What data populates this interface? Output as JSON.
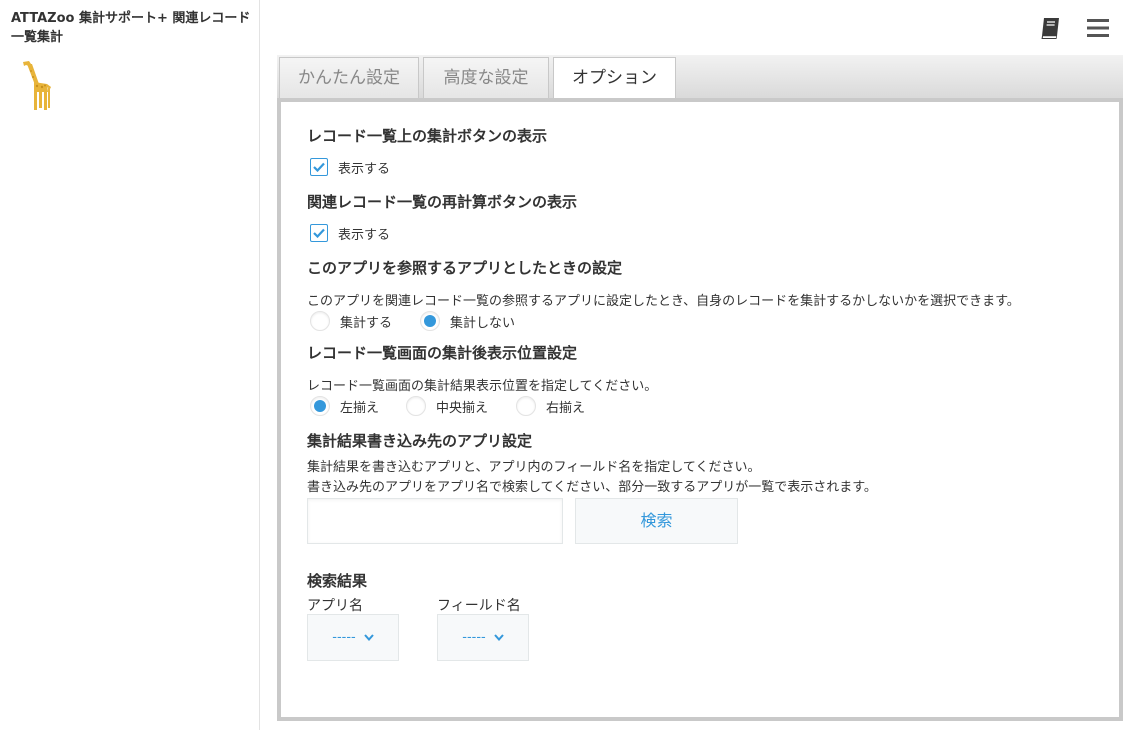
{
  "sidebar": {
    "app_title": "ATTAZoo 集計サポート+ 関連レコード一覧集計",
    "logo_icon": "giraffe-icon"
  },
  "header": {
    "icons": [
      "book-icon",
      "menu-icon"
    ]
  },
  "tabs": [
    {
      "label": "かんたん設定",
      "active": false
    },
    {
      "label": "高度な設定",
      "active": false
    },
    {
      "label": "オプション",
      "active": true
    }
  ],
  "sections": {
    "list_button": {
      "title": "レコード一覧上の集計ボタンの表示",
      "checkbox_label": "表示する",
      "checked": true
    },
    "recalc_button": {
      "title": "関連レコード一覧の再計算ボタンの表示",
      "checkbox_label": "表示する",
      "checked": true
    },
    "reference_app": {
      "title": "このアプリを参照するアプリとしたときの設定",
      "description": "このアプリを関連レコード一覧の参照するアプリに設定したとき、自身のレコードを集計するかしないかを選択できます。",
      "options": [
        "集計する",
        "集計しない"
      ],
      "selected": "集計しない"
    },
    "display_position": {
      "title": "レコード一覧画面の集計後表示位置設定",
      "description": "レコード一覧画面の集計結果表示位置を指定してください。",
      "options": [
        "左揃え",
        "中央揃え",
        "右揃え"
      ],
      "selected": "左揃え"
    },
    "write_target": {
      "title": "集計結果書き込み先のアプリ設定",
      "description_1": "集計結果を書き込むアプリと、アプリ内のフィールド名を指定してください。",
      "description_2": "書き込み先のアプリをアプリ名で検索してください、部分一致するアプリが一覧で表示されます。",
      "search_value": "",
      "search_button": "検索"
    },
    "results": {
      "title": "検索結果",
      "app_label": "アプリ名",
      "field_label": "フィールド名",
      "app_value": "-----",
      "field_value": "-----"
    }
  },
  "colors": {
    "accent": "#3498db",
    "logo": "#e8b43a",
    "panel_border": "#c9c9c9"
  }
}
